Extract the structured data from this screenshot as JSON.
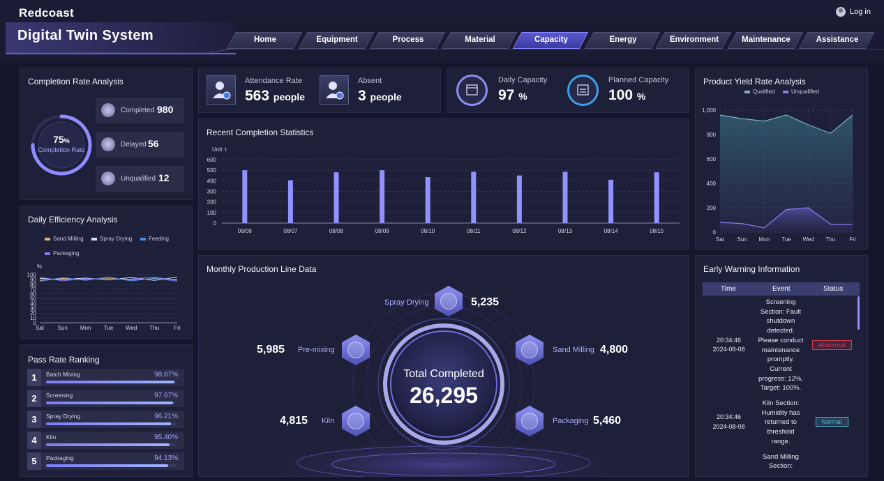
{
  "header": {
    "brand": "Redcoast",
    "title": "Digital Twin System",
    "login": "Log in",
    "nav": [
      "Home",
      "Equipment",
      "Process",
      "Material",
      "Capacity",
      "Energy",
      "Environment",
      "Maintenance",
      "Assistance"
    ],
    "active": "Capacity"
  },
  "completion": {
    "title": "Completion Rate Analysis",
    "rate_value": "75",
    "rate_unit": "%",
    "rate_label": "Completion Rate",
    "rate": 0.75,
    "stats": [
      {
        "label": "Completed",
        "value": "980"
      },
      {
        "label": "Delayed",
        "value": "56"
      },
      {
        "label": "Unqualified",
        "value": "12"
      }
    ]
  },
  "top_cards": {
    "attendance_label": "Attendance Rate",
    "attendance_value": "563",
    "attendance_unit": "people",
    "absent_label": "Absent",
    "absent_value": "3",
    "absent_unit": "people",
    "daily_label": "Daily Capacity",
    "daily_value": "97",
    "daily_unit": "%",
    "planned_label": "Planned Capacity",
    "planned_value": "100",
    "planned_unit": "%"
  },
  "chart_data": [
    {
      "type": "bar",
      "title": "Recent Completion Statistics",
      "unit_label": "Unit: t",
      "categories": [
        "08/06",
        "08/07",
        "08/08",
        "08/09",
        "08/10",
        "08/11",
        "08/12",
        "08/13",
        "08/14",
        "08/15"
      ],
      "values": [
        500,
        405,
        480,
        500,
        435,
        485,
        450,
        485,
        410,
        480
      ],
      "ylim": [
        0,
        600
      ],
      "yticks": [
        "0",
        "100",
        "200",
        "300",
        "400",
        "500",
        "600"
      ],
      "grid": true,
      "color": "#8f92ff"
    },
    {
      "type": "area",
      "title": "Product Yield Rate Analysis",
      "categories": [
        "Sat",
        "Sun",
        "Mon",
        "Tue",
        "Wed",
        "Thu",
        "Fri"
      ],
      "series": [
        {
          "name": "Qualified",
          "values": [
            960,
            930,
            910,
            960,
            880,
            810,
            960
          ],
          "color": "#78b3c8"
        },
        {
          "name": "Unqualified",
          "values": [
            80,
            70,
            35,
            185,
            200,
            65,
            65
          ],
          "color": "#8a7cf0"
        }
      ],
      "ylim": [
        0,
        1000
      ],
      "yticks": [
        "0",
        "200",
        "400",
        "600",
        "800",
        "1,000"
      ],
      "legend": "top"
    },
    {
      "type": "line",
      "title": "Daily Efficiency Analysis",
      "unit_label": "%",
      "categories": [
        "Sat",
        "Sun",
        "Mon",
        "Tue",
        "Wed",
        "Thu",
        "Fri"
      ],
      "series": [
        {
          "name": "Sand Milling",
          "values": [
            88,
            92,
            90,
            93,
            89,
            92,
            90
          ],
          "color": "#e8b47a"
        },
        {
          "name": "Spray Drying",
          "values": [
            92,
            90,
            93,
            89,
            94,
            88,
            95
          ],
          "color": "#cfe4ff"
        },
        {
          "name": "Feeding",
          "values": [
            86,
            94,
            88,
            95,
            87,
            93,
            86
          ],
          "color": "#3f8de8"
        },
        {
          "name": "Packaging",
          "values": [
            95,
            87,
            92,
            90,
            91,
            95,
            88
          ],
          "color": "#8a7cf0"
        }
      ],
      "ylim": [
        0,
        100
      ],
      "yticks": [
        "0",
        "10",
        "20",
        "30",
        "40",
        "50",
        "60",
        "70",
        "80",
        "90",
        "100"
      ],
      "legend": "top"
    }
  ],
  "pass_rate": {
    "title": "Pass Rate Ranking",
    "items": [
      {
        "rank": "1",
        "name": "Batch Mixing",
        "pct": "98.87%",
        "value": 0.9887
      },
      {
        "rank": "2",
        "name": "Screening",
        "pct": "97.67%",
        "value": 0.9767
      },
      {
        "rank": "3",
        "name": "Spray Drying",
        "pct": "96.21%",
        "value": 0.9621
      },
      {
        "rank": "4",
        "name": "Kiln",
        "pct": "95.40%",
        "value": 0.954
      },
      {
        "rank": "5",
        "name": "Packaging",
        "pct": "94.13%",
        "value": 0.9413
      }
    ]
  },
  "monthly": {
    "title": "Monthly Production Line Data",
    "total_label": "Total Completed",
    "total_value": "26,295",
    "lines": {
      "spray_drying": {
        "label": "Spray Drying",
        "value": "5,235"
      },
      "pre_mixing": {
        "label": "Pre-mixing",
        "value": "5,985"
      },
      "sand_milling": {
        "label": "Sand Milling",
        "value": "4,800"
      },
      "kiln": {
        "label": "Kiln",
        "value": "4,815"
      },
      "packaging": {
        "label": "Packaging",
        "value": "5,460"
      }
    }
  },
  "warning": {
    "title": "Early Warning Information",
    "columns": [
      "Time",
      "Event",
      "Status"
    ],
    "rows": [
      {
        "time": "20:34:46",
        "date": "2024-08-08",
        "event": [
          "Screening",
          "Section: Fault",
          "shutdown",
          "detected.",
          "Please conduct",
          "maintenance",
          "promptly.",
          "Current",
          "progress: 12%,",
          "Target: 100%."
        ],
        "status": "Abnormal",
        "status_color": "#d23b50"
      },
      {
        "time": "20:34:46",
        "date": "2024-08-08",
        "event": [
          "Kiln Section:",
          "Humidity has",
          "returned to",
          "threshold",
          "range."
        ],
        "status": "Normal",
        "status_color": "#4fb4cf"
      },
      {
        "time": "",
        "date": "",
        "event": [
          "Sand Milling",
          "Section:"
        ],
        "status": "",
        "status_color": ""
      }
    ]
  },
  "icons": {
    "user": "user-icon",
    "calendar": "calendar-icon",
    "clock": "clock-icon",
    "check": "check-icon"
  }
}
